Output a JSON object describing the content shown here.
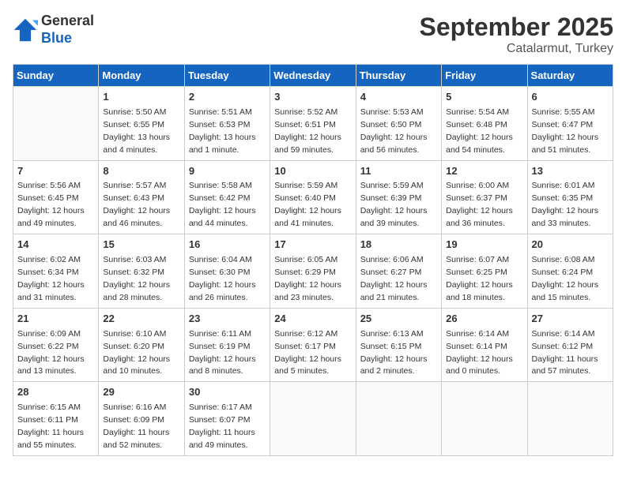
{
  "logo": {
    "general": "General",
    "blue": "Blue"
  },
  "header": {
    "month_year": "September 2025",
    "location": "Catalarmut, Turkey"
  },
  "days_of_week": [
    "Sunday",
    "Monday",
    "Tuesday",
    "Wednesday",
    "Thursday",
    "Friday",
    "Saturday"
  ],
  "weeks": [
    [
      {
        "day": "",
        "sunrise": "",
        "sunset": "",
        "daylight": ""
      },
      {
        "day": "1",
        "sunrise": "Sunrise: 5:50 AM",
        "sunset": "Sunset: 6:55 PM",
        "daylight": "Daylight: 13 hours and 4 minutes."
      },
      {
        "day": "2",
        "sunrise": "Sunrise: 5:51 AM",
        "sunset": "Sunset: 6:53 PM",
        "daylight": "Daylight: 13 hours and 1 minute."
      },
      {
        "day": "3",
        "sunrise": "Sunrise: 5:52 AM",
        "sunset": "Sunset: 6:51 PM",
        "daylight": "Daylight: 12 hours and 59 minutes."
      },
      {
        "day": "4",
        "sunrise": "Sunrise: 5:53 AM",
        "sunset": "Sunset: 6:50 PM",
        "daylight": "Daylight: 12 hours and 56 minutes."
      },
      {
        "day": "5",
        "sunrise": "Sunrise: 5:54 AM",
        "sunset": "Sunset: 6:48 PM",
        "daylight": "Daylight: 12 hours and 54 minutes."
      },
      {
        "day": "6",
        "sunrise": "Sunrise: 5:55 AM",
        "sunset": "Sunset: 6:47 PM",
        "daylight": "Daylight: 12 hours and 51 minutes."
      }
    ],
    [
      {
        "day": "7",
        "sunrise": "Sunrise: 5:56 AM",
        "sunset": "Sunset: 6:45 PM",
        "daylight": "Daylight: 12 hours and 49 minutes."
      },
      {
        "day": "8",
        "sunrise": "Sunrise: 5:57 AM",
        "sunset": "Sunset: 6:43 PM",
        "daylight": "Daylight: 12 hours and 46 minutes."
      },
      {
        "day": "9",
        "sunrise": "Sunrise: 5:58 AM",
        "sunset": "Sunset: 6:42 PM",
        "daylight": "Daylight: 12 hours and 44 minutes."
      },
      {
        "day": "10",
        "sunrise": "Sunrise: 5:59 AM",
        "sunset": "Sunset: 6:40 PM",
        "daylight": "Daylight: 12 hours and 41 minutes."
      },
      {
        "day": "11",
        "sunrise": "Sunrise: 5:59 AM",
        "sunset": "Sunset: 6:39 PM",
        "daylight": "Daylight: 12 hours and 39 minutes."
      },
      {
        "day": "12",
        "sunrise": "Sunrise: 6:00 AM",
        "sunset": "Sunset: 6:37 PM",
        "daylight": "Daylight: 12 hours and 36 minutes."
      },
      {
        "day": "13",
        "sunrise": "Sunrise: 6:01 AM",
        "sunset": "Sunset: 6:35 PM",
        "daylight": "Daylight: 12 hours and 33 minutes."
      }
    ],
    [
      {
        "day": "14",
        "sunrise": "Sunrise: 6:02 AM",
        "sunset": "Sunset: 6:34 PM",
        "daylight": "Daylight: 12 hours and 31 minutes."
      },
      {
        "day": "15",
        "sunrise": "Sunrise: 6:03 AM",
        "sunset": "Sunset: 6:32 PM",
        "daylight": "Daylight: 12 hours and 28 minutes."
      },
      {
        "day": "16",
        "sunrise": "Sunrise: 6:04 AM",
        "sunset": "Sunset: 6:30 PM",
        "daylight": "Daylight: 12 hours and 26 minutes."
      },
      {
        "day": "17",
        "sunrise": "Sunrise: 6:05 AM",
        "sunset": "Sunset: 6:29 PM",
        "daylight": "Daylight: 12 hours and 23 minutes."
      },
      {
        "day": "18",
        "sunrise": "Sunrise: 6:06 AM",
        "sunset": "Sunset: 6:27 PM",
        "daylight": "Daylight: 12 hours and 21 minutes."
      },
      {
        "day": "19",
        "sunrise": "Sunrise: 6:07 AM",
        "sunset": "Sunset: 6:25 PM",
        "daylight": "Daylight: 12 hours and 18 minutes."
      },
      {
        "day": "20",
        "sunrise": "Sunrise: 6:08 AM",
        "sunset": "Sunset: 6:24 PM",
        "daylight": "Daylight: 12 hours and 15 minutes."
      }
    ],
    [
      {
        "day": "21",
        "sunrise": "Sunrise: 6:09 AM",
        "sunset": "Sunset: 6:22 PM",
        "daylight": "Daylight: 12 hours and 13 minutes."
      },
      {
        "day": "22",
        "sunrise": "Sunrise: 6:10 AM",
        "sunset": "Sunset: 6:20 PM",
        "daylight": "Daylight: 12 hours and 10 minutes."
      },
      {
        "day": "23",
        "sunrise": "Sunrise: 6:11 AM",
        "sunset": "Sunset: 6:19 PM",
        "daylight": "Daylight: 12 hours and 8 minutes."
      },
      {
        "day": "24",
        "sunrise": "Sunrise: 6:12 AM",
        "sunset": "Sunset: 6:17 PM",
        "daylight": "Daylight: 12 hours and 5 minutes."
      },
      {
        "day": "25",
        "sunrise": "Sunrise: 6:13 AM",
        "sunset": "Sunset: 6:15 PM",
        "daylight": "Daylight: 12 hours and 2 minutes."
      },
      {
        "day": "26",
        "sunrise": "Sunrise: 6:14 AM",
        "sunset": "Sunset: 6:14 PM",
        "daylight": "Daylight: 12 hours and 0 minutes."
      },
      {
        "day": "27",
        "sunrise": "Sunrise: 6:14 AM",
        "sunset": "Sunset: 6:12 PM",
        "daylight": "Daylight: 11 hours and 57 minutes."
      }
    ],
    [
      {
        "day": "28",
        "sunrise": "Sunrise: 6:15 AM",
        "sunset": "Sunset: 6:11 PM",
        "daylight": "Daylight: 11 hours and 55 minutes."
      },
      {
        "day": "29",
        "sunrise": "Sunrise: 6:16 AM",
        "sunset": "Sunset: 6:09 PM",
        "daylight": "Daylight: 11 hours and 52 minutes."
      },
      {
        "day": "30",
        "sunrise": "Sunrise: 6:17 AM",
        "sunset": "Sunset: 6:07 PM",
        "daylight": "Daylight: 11 hours and 49 minutes."
      },
      {
        "day": "",
        "sunrise": "",
        "sunset": "",
        "daylight": ""
      },
      {
        "day": "",
        "sunrise": "",
        "sunset": "",
        "daylight": ""
      },
      {
        "day": "",
        "sunrise": "",
        "sunset": "",
        "daylight": ""
      },
      {
        "day": "",
        "sunrise": "",
        "sunset": "",
        "daylight": ""
      }
    ]
  ]
}
